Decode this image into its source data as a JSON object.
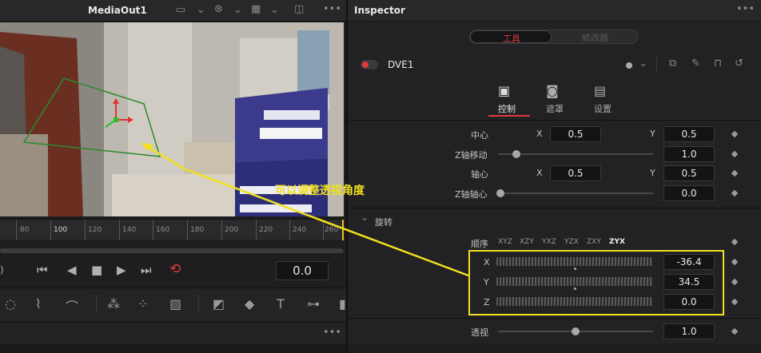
{
  "viewer": {
    "title": "MediaOut1",
    "menu": "•••"
  },
  "timeline": {
    "ticks": [
      "80",
      "100",
      "120",
      "140",
      "160",
      "180",
      "200",
      "220",
      "240",
      "260"
    ],
    "timecode": "0.0"
  },
  "inspector": {
    "title": "Inspector",
    "tabs": {
      "tools": "工具",
      "modifiers": "修改器"
    },
    "node_name": "DVE1",
    "subtabs": [
      "控制",
      "遮罩",
      "设置"
    ],
    "rows": {
      "center": {
        "label": "中心",
        "x_label": "X",
        "x": "0.5",
        "y_label": "Y",
        "y": "0.5"
      },
      "zmove": {
        "label": "Z轴移动",
        "value": "1.0"
      },
      "pivot": {
        "label": "轴心",
        "x_label": "X",
        "x": "0.5",
        "y_label": "Y",
        "y": "0.5"
      },
      "zpivot": {
        "label": "Z轴轴心",
        "value": "0.0"
      },
      "rotation": {
        "label": "旋转"
      },
      "order": {
        "label": "顺序",
        "options": [
          "XYZ",
          "XZY",
          "YXZ",
          "YZX",
          "ZXY",
          "ZYX"
        ],
        "selected": "ZYX"
      },
      "rx": {
        "label": "X",
        "value": "-36.4"
      },
      "ry": {
        "label": "Y",
        "value": "34.5"
      },
      "rz": {
        "label": "Z",
        "value": "0.0"
      },
      "perspective": {
        "label": "透视",
        "value": "1.0"
      }
    }
  },
  "annotation": {
    "text": "可以调整透视角度",
    "color": "#f0e020"
  },
  "colors": {
    "accent_red": "#e03a3a",
    "highlight": "#f0e020"
  }
}
